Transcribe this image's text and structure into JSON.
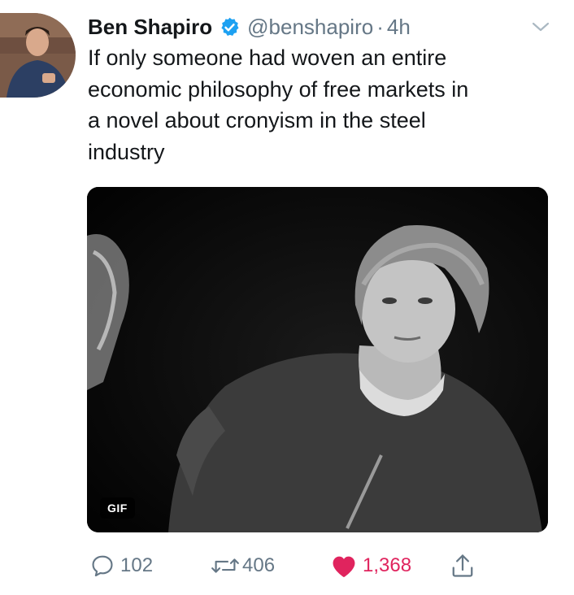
{
  "tweet": {
    "display_name": "Ben Shapiro",
    "handle": "@benshapiro",
    "separator": "·",
    "time": "4h",
    "text_lines": [
      "If only someone had woven an entire",
      "economic philosophy of free markets  in",
      "a novel about cronyism in the steel",
      "industry"
    ],
    "media": {
      "badge": "GIF"
    },
    "actions": {
      "replies": "102",
      "retweets": "406",
      "likes": "1,368"
    }
  },
  "icons": {
    "verified": "verified-badge-icon",
    "caret": "chevron-down-icon",
    "reply": "reply-icon",
    "retweet": "retweet-icon",
    "like": "heart-icon",
    "share": "share-icon"
  },
  "colors": {
    "verified_blue": "#1da1f2",
    "muted_gray": "#657786",
    "like_red": "#e0245e",
    "text": "#14171a"
  }
}
